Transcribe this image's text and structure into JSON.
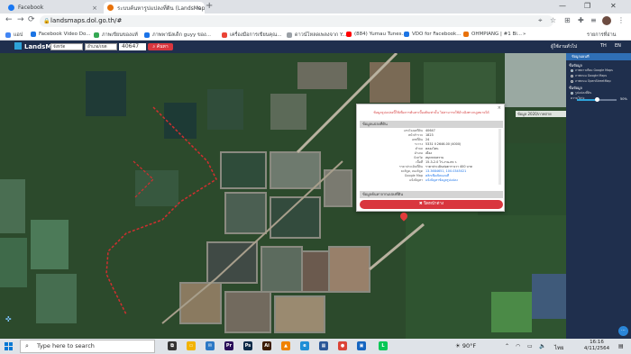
{
  "browser": {
    "tabs": [
      {
        "title": "Facebook",
        "close": "×"
      },
      {
        "title": "ระบบค้นหารูปแปลงที่ดิน (LandsMaps)",
        "close": "×"
      }
    ],
    "new_tab": "+",
    "window_controls": [
      "—",
      "❐",
      "✕"
    ],
    "nav": {
      "back": "←",
      "forward": "→",
      "reload": "⟳"
    },
    "url": "landsmaps.dol.go.th/#",
    "bookmarks": [
      {
        "label": "แอป",
        "color": "#4285f4"
      },
      {
        "label": "Facebook Video Do...",
        "color": "#1b74e4"
      },
      {
        "label": "ภาพเขียนของแท้",
        "color": "#34a853"
      },
      {
        "label": "ภาพพานัลเด็ก guyy ของ...",
        "color": "#1a73e8"
      },
      {
        "label": "เครื่องมือการเขียนคุณ...",
        "color": "#ea4335"
      },
      {
        "label": "ดาวน์โหลดเพลงจาก Y...",
        "color": "#9aa0a6"
      },
      {
        "label": "(884) Yumau Tunes...",
        "color": "#ff0000"
      },
      {
        "label": "VDO for Facebook...",
        "color": "#1b74e4"
      },
      {
        "label": "OHMPIANG | #1 Bi...",
        "color": "#e8710a"
      }
    ],
    "bookmarks_more": "»",
    "reading_list": "รายการที่อ่าน"
  },
  "landsmaps": {
    "logo": "LandsMaps",
    "province": "จังหวัด",
    "district": "อำเภอ/เขต",
    "parcel_no": "40647",
    "search_label": "ค้นหา",
    "user": "ผู้ใช้งานทั่วไป",
    "lang": [
      "TH",
      "EN"
    ]
  },
  "map": {
    "tag": "ข้อมูล 2020/ภาพถ่าย",
    "popup": {
      "close": "×",
      "notice": "ข้อมูลรูปแปลงนี้ใช้เพื่อการค้นหาเบื้องต้นเท่านั้น ไม่สามารถใช้อ้างอิงทางกฎหมายได้",
      "section1": "ข้อมูลแปลงที่ดิน",
      "rows": [
        {
          "k": "เลขโฉนดที่ดิน",
          "v": "40647"
        },
        {
          "k": "หน้าสำรวจ",
          "v": "1823"
        },
        {
          "k": "เลขที่ดิน",
          "v": "24"
        },
        {
          "k": "ระวาง",
          "v": "5331 II 2646-00 (4000)"
        },
        {
          "k": "ตำบล",
          "v": "คลองโคน"
        },
        {
          "k": "อำเภอ",
          "v": "เมือง"
        },
        {
          "k": "จังหวัด",
          "v": "สมุทรสงคราม"
        },
        {
          "k": "เนื้อที่",
          "v": "15-3-2.0 ไร่-งาน-ตร.ว."
        },
        {
          "k": "ราคาประเมินที่ดิน",
          "v": "ราคาประเมินต่อตารางวา 400 บาท"
        },
        {
          "k": "ละติจูด, ลองจิจูด",
          "v": "13.3684651, 100.0345021"
        },
        {
          "k": "Google Map",
          "v": "คลิกเพื่อเปิดแผนที่"
        },
        {
          "k": "แจ้งปัญหา",
          "v": "แจ้งปัญหาข้อมูลรูปแปลง"
        }
      ],
      "section2": "ข้อมูลค้นหาจากแปลงที่ดิน",
      "button": "ปิดหน้าต่าง"
    }
  },
  "right_panel": {
    "title": "ข้อมูลแผนที่",
    "base_title": "ชั้นข้อมูล",
    "base_layers": [
      {
        "label": "ภาพดาวเทียม Google Maps",
        "on": true
      },
      {
        "label": "ภาพถนน Google Maps",
        "on": false
      },
      {
        "label": "ภาพถนน OpenStreetMap",
        "on": false
      }
    ],
    "overlay_title": "ชั้นข้อมูล",
    "overlay": "รูปแปลงที่ดิน",
    "opacity_label": "ความโปร่ง",
    "opacity": 0.5,
    "opacity_text": "50%"
  },
  "taskbar": {
    "search_placeholder": "Type here to search",
    "weather": "90°F",
    "lang": "ไทย",
    "time": "16:16",
    "date": "4/11/2564",
    "apps": [
      {
        "name": "task-view",
        "label": "⧉",
        "color": "#333333"
      },
      {
        "name": "file-explorer",
        "label": "▭",
        "color": "#f2b300"
      },
      {
        "name": "mail",
        "label": "✉",
        "color": "#2b78c5"
      },
      {
        "name": "premiere",
        "label": "Pr",
        "color": "#2a0f59"
      },
      {
        "name": "photoshop",
        "label": "Ps",
        "color": "#0c2a48"
      },
      {
        "name": "illustrator",
        "label": "Ai",
        "color": "#3a1b00"
      },
      {
        "name": "vlc",
        "label": "▲",
        "color": "#f08200"
      },
      {
        "name": "edge",
        "label": "e",
        "color": "#1f8fd6"
      },
      {
        "name": "store",
        "label": "▦",
        "color": "#2b5797"
      },
      {
        "name": "chrome",
        "label": "●",
        "color": "#db4437"
      },
      {
        "name": "photos",
        "label": "▣",
        "color": "#1565c0"
      },
      {
        "name": "line",
        "label": "L",
        "color": "#06c755"
      }
    ]
  }
}
